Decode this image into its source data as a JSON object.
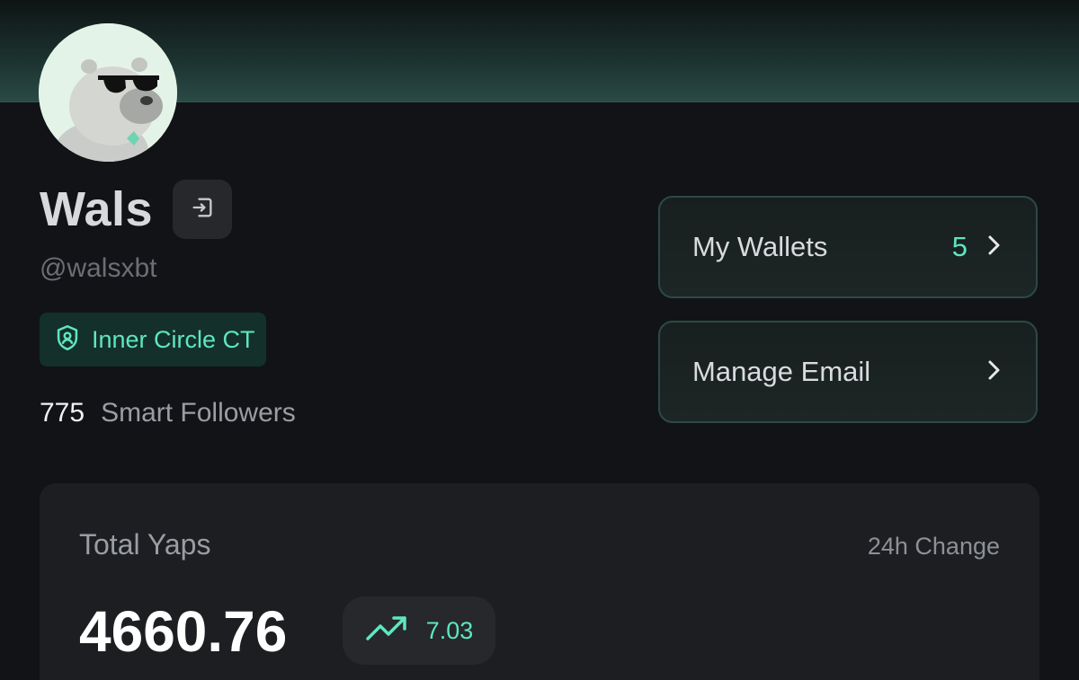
{
  "profile": {
    "name": "Wals",
    "handle": "@walsxbt",
    "badge": "Inner Circle CT",
    "smart_followers_count": "775",
    "smart_followers_label": "Smart Followers"
  },
  "actions": {
    "wallets_label": "My Wallets",
    "wallets_count": "5",
    "email_label": "Manage Email"
  },
  "stats": {
    "title": "Total Yaps",
    "change_label": "24h Change",
    "total": "4660.76",
    "change": "7.03"
  },
  "icons": {
    "logout": "logout-icon",
    "badge": "shield-user-icon",
    "chevron": "chevron-right-icon",
    "trend": "trending-up-icon"
  },
  "colors": {
    "background": "#111317",
    "accent": "#5ee6bf",
    "card": "#1c1e22",
    "button_border": "#2b4a45"
  }
}
